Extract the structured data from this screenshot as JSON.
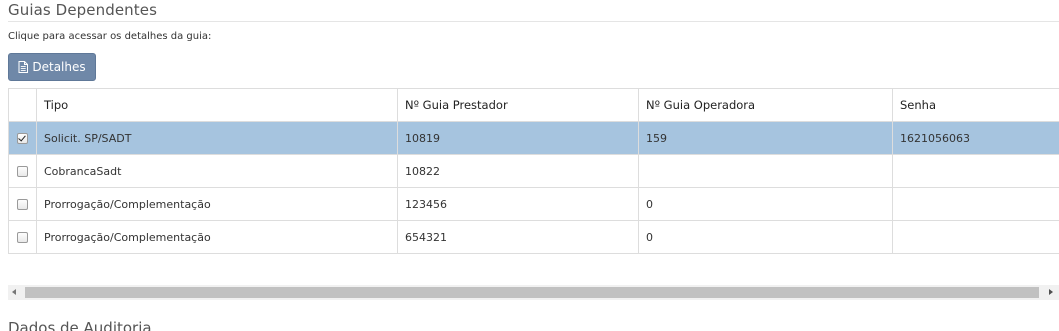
{
  "section": {
    "title": "Guias Dependentes",
    "hint": "Clique para acessar os detalhes da guia:"
  },
  "toolbar": {
    "details_label": "Detalhes",
    "details_icon": "document-icon"
  },
  "table": {
    "headers": [
      "Tipo",
      "Nº Guia Prestador",
      "Nº Guia Operadora",
      "Senha"
    ],
    "rows": [
      {
        "checked": true,
        "tipo": "Solicit. SP/SADT",
        "prestador": "10819",
        "operadora": "159",
        "senha": "1621056063"
      },
      {
        "checked": false,
        "tipo": "CobrancaSadt",
        "prestador": "10822",
        "operadora": "",
        "senha": ""
      },
      {
        "checked": false,
        "tipo": "Prorrogação/Complementação",
        "prestador": "123456",
        "operadora": "0",
        "senha": ""
      },
      {
        "checked": false,
        "tipo": "Prorrogação/Complementação",
        "prestador": "654321",
        "operadora": "0",
        "senha": ""
      }
    ],
    "selected_row_color": "#a6c4df"
  },
  "next_section": {
    "title": "Dados de Auditoria"
  },
  "colors": {
    "button_bg": "#6f88a8",
    "border": "#dddddd"
  }
}
